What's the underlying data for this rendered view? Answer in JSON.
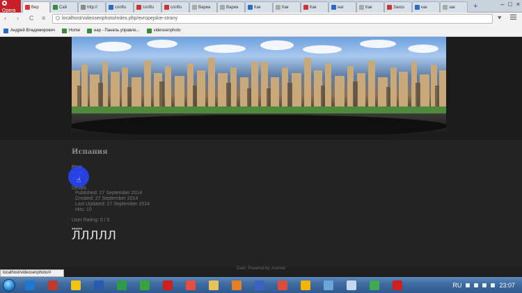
{
  "browser": {
    "menu_label": "Opera",
    "tabs": [
      {
        "label": "Вер",
        "color": "#d33"
      },
      {
        "label": "Сай",
        "color": "#3a8a3a"
      },
      {
        "label": "http://",
        "color": "#888"
      },
      {
        "label": "conflu",
        "color": "#2a6ac8"
      },
      {
        "label": "conflu",
        "color": "#c33"
      },
      {
        "label": "conflu",
        "color": "#c33"
      },
      {
        "label": "Вариа",
        "color": "#aaa"
      },
      {
        "label": "Вариа",
        "color": "#aaa"
      },
      {
        "label": "Как",
        "color": "#2a6ac8"
      },
      {
        "label": "Как",
        "color": "#aaa"
      },
      {
        "label": "Как",
        "color": "#c33"
      },
      {
        "label": "наг",
        "color": "#2a6ac8"
      },
      {
        "label": "Как",
        "color": "#aaa"
      },
      {
        "label": "Захоз",
        "color": "#c33"
      },
      {
        "label": "как",
        "color": "#2a6ac8"
      },
      {
        "label": "зак",
        "color": "#aaa"
      }
    ],
    "new_tab_label": "+",
    "window_controls": [
      "–",
      "□",
      "×"
    ],
    "back": "‹",
    "forward": "›",
    "reload": "C",
    "menu_icon": "≡",
    "url": "localhost/videosenphoto/index.php/evropejskie-strany",
    "bookmark_heart": "♥",
    "bookmarks": [
      {
        "label": "Андрей Владимирович",
        "color": "#2a6ac8"
      },
      {
        "label": "Home",
        "color": "#3a8a3a"
      },
      {
        "label": "нар - Панель управле...",
        "color": "#3a8a3a"
      },
      {
        "label": "videosenphoto",
        "color": "#3a8a3a"
      }
    ]
  },
  "article": {
    "title": "Испания",
    "print_label": "Print",
    "email_label": "Email",
    "edit_label": "Edit",
    "details_title": "Details",
    "published": "Published: 27 September 2014",
    "created": "Created: 27 September 2014",
    "updated": "Last Updated: 27 September 2014",
    "hits": "Hits: 10",
    "rating": "User Rating: 0 / 5",
    "stars": "●●●●●",
    "lambda_row": "ЛЛЛЛЛ"
  },
  "footer": "Сайт. Powered by Joomla!",
  "status_url": "localhost/videosenphoto/#",
  "taskbar": {
    "icons": [
      {
        "name": "explorer-icon",
        "color": "#1e78d0"
      },
      {
        "name": "drawing-app-icon",
        "color": "#c0392b"
      },
      {
        "name": "drive-icon",
        "color": "#f1c40f"
      },
      {
        "name": "word-icon",
        "color": "#2a5ab0"
      },
      {
        "name": "green-app-icon",
        "color": "#2e9a4a"
      },
      {
        "name": "utorrent-icon",
        "color": "#36a53a"
      },
      {
        "name": "opera-icon",
        "color": "#d0201e"
      },
      {
        "name": "paint-icon",
        "color": "#e74c3c"
      },
      {
        "name": "folder-icon",
        "color": "#e8c25a"
      },
      {
        "name": "media-player-icon",
        "color": "#e67e22"
      },
      {
        "name": "floppy-icon",
        "color": "#3b62c2"
      },
      {
        "name": "chrome-icon",
        "color": "#dd4b39"
      },
      {
        "name": "drive-icon-2",
        "color": "#f4b400"
      },
      {
        "name": "tablet-icon",
        "color": "#6aa4d8"
      },
      {
        "name": "document-icon",
        "color": "#c8d8ec"
      },
      {
        "name": "green-app-icon-2",
        "color": "#3faa52"
      },
      {
        "name": "opera-icon-2",
        "color": "#d0201e"
      }
    ],
    "language": "RU",
    "clock": "23:07"
  }
}
